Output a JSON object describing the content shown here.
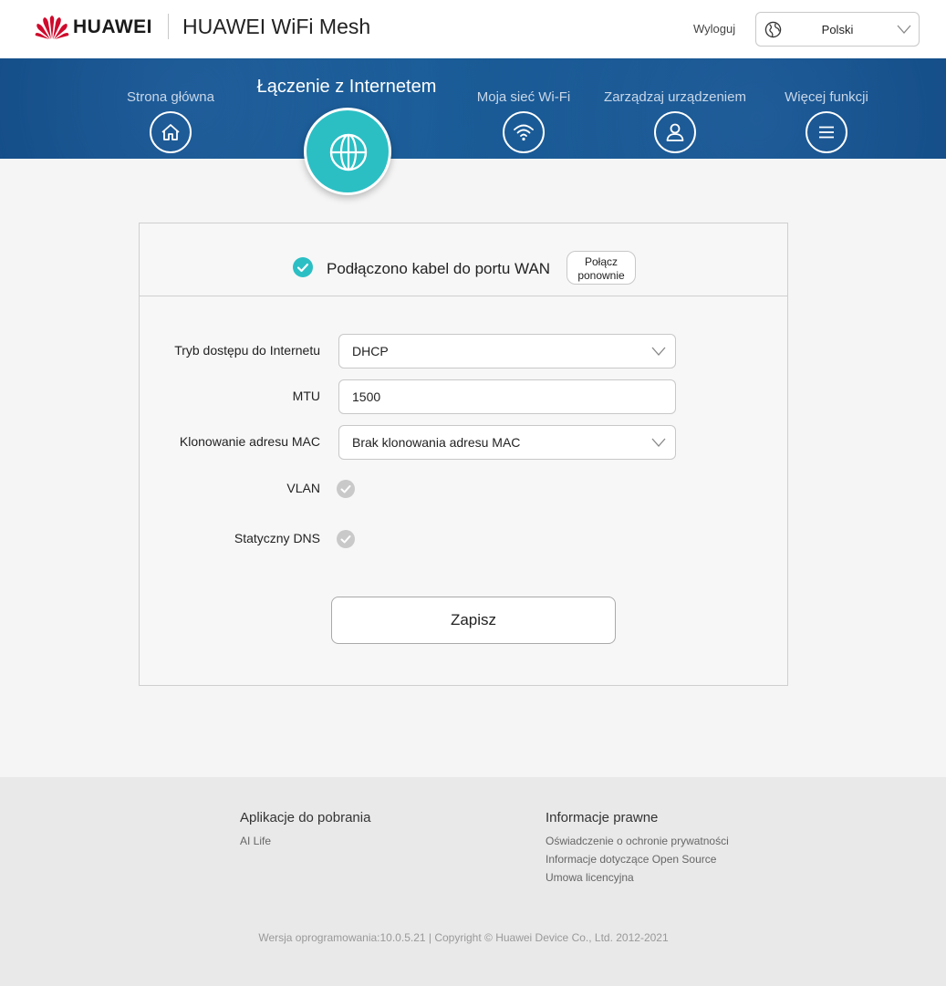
{
  "header": {
    "brand": "HUAWEI",
    "product_title": "HUAWEI WiFi Mesh",
    "logout_label": "Wyloguj",
    "language": "Polski",
    "brand_color": "#cf0a2c"
  },
  "nav": {
    "items": [
      {
        "label": "Strona główna",
        "icon": "home-icon"
      },
      {
        "label": "Łączenie z Internetem",
        "icon": "globe-icon",
        "active": true
      },
      {
        "label": "Moja sieć Wi-Fi",
        "icon": "wifi-icon"
      },
      {
        "label": "Zarządzaj urządzeniem",
        "icon": "user-icon"
      },
      {
        "label": "Więcej funkcji",
        "icon": "menu-icon"
      }
    ],
    "accent_color": "#2bbfc4",
    "background_color": "#165390"
  },
  "status": {
    "text": "Podłączono kabel do portu WAN",
    "reconnect_label_line1": "Połącz",
    "reconnect_label_line2": "ponownie"
  },
  "form": {
    "access_mode_label": "Tryb dostępu do Internetu",
    "access_mode_value": "DHCP",
    "mtu_label": "MTU",
    "mtu_value": "1500",
    "mac_clone_label": "Klonowanie adresu MAC",
    "mac_clone_value": "Brak klonowania adresu MAC",
    "vlan_label": "VLAN",
    "static_dns_label": "Statyczny DNS",
    "save_label": "Zapisz"
  },
  "footer": {
    "apps_heading": "Aplikacje do pobrania",
    "apps_links": [
      "AI Life"
    ],
    "legal_heading": "Informacje prawne",
    "legal_links": [
      "Oświadczenie o ochronie prywatności",
      "Informacje dotyczące Open Source",
      "Umowa licencyjna"
    ],
    "copyright": "Wersja oprogramowania:10.0.5.21 |  Copyright © Huawei Device Co., Ltd. 2012-2021"
  }
}
